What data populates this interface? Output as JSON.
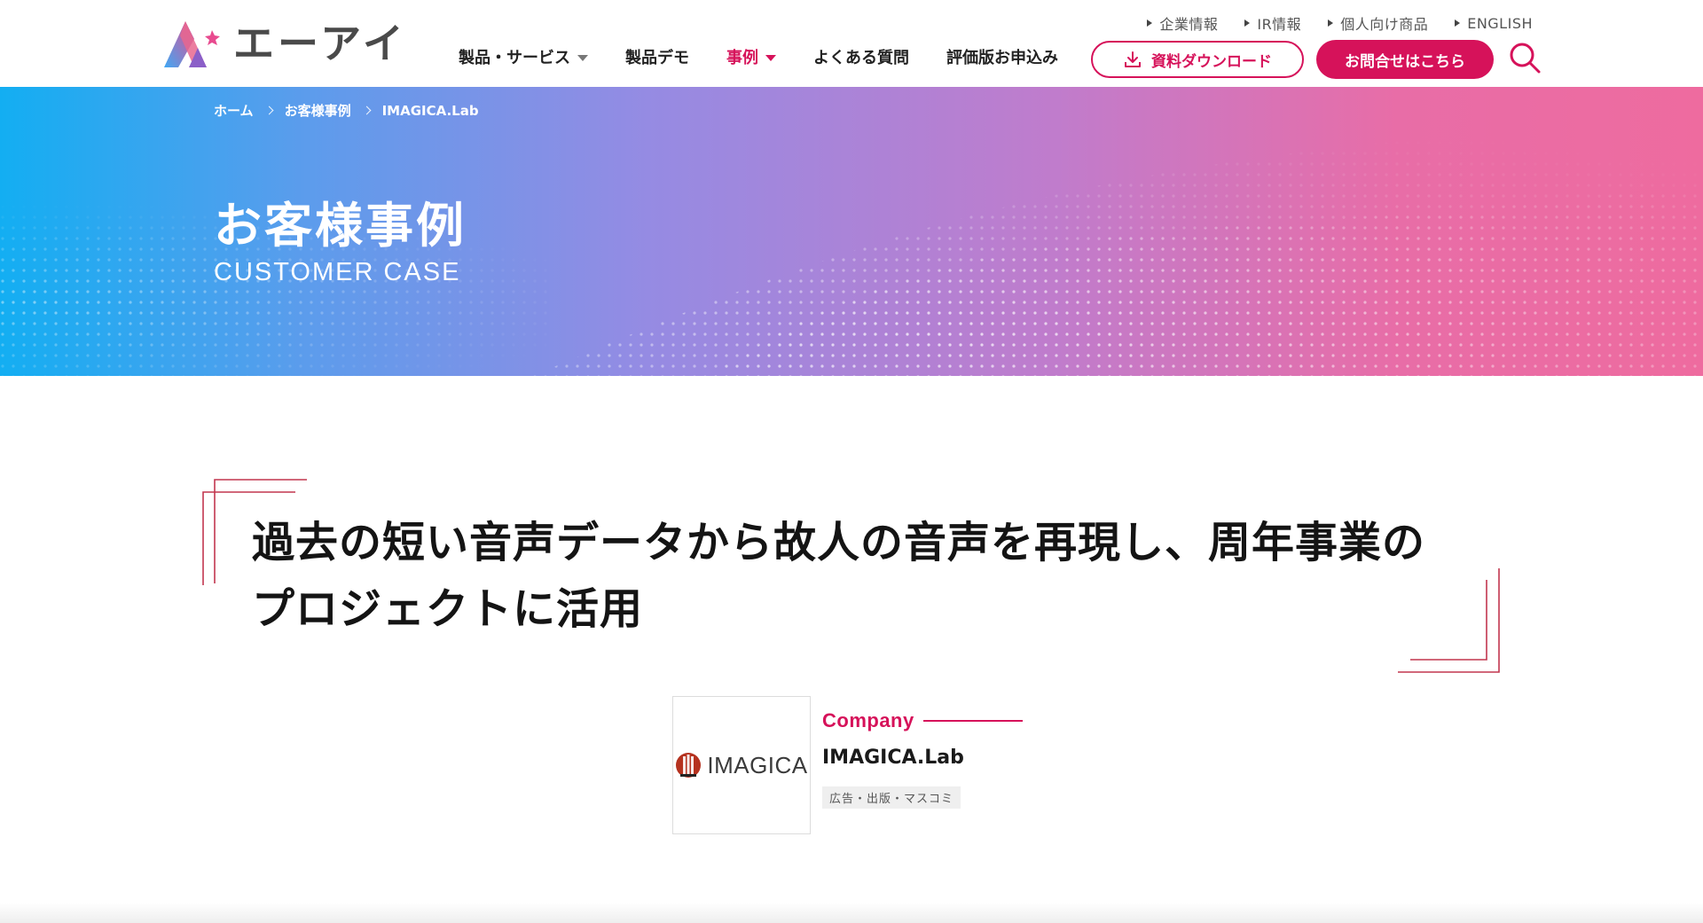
{
  "header": {
    "logo_text": "エーアイ",
    "util_nav": [
      {
        "label": "企業情報"
      },
      {
        "label": "IR情報"
      },
      {
        "label": "個人向け商品"
      },
      {
        "label": "ENGLISH"
      }
    ],
    "main_nav": [
      {
        "label": "製品・サービス",
        "has_dropdown": true,
        "active": false
      },
      {
        "label": "製品デモ",
        "has_dropdown": false,
        "active": false
      },
      {
        "label": "事例",
        "has_dropdown": true,
        "active": true
      },
      {
        "label": "よくある質問",
        "has_dropdown": false,
        "active": false
      },
      {
        "label": "評価版お申込み",
        "has_dropdown": false,
        "active": false
      }
    ],
    "download_button": "資料ダウンロード",
    "contact_button": "お問合せはこちら",
    "search_icon": "search-icon"
  },
  "hero": {
    "breadcrumb": [
      "ホーム",
      "お客様事例",
      "IMAGICA.Lab"
    ],
    "title": "お客様事例",
    "subtitle": "CUSTOMER CASE"
  },
  "article": {
    "headline_line1": "過去の短い音声データから故人の音声を再現し、周年事業の",
    "headline_line2": "プロジェクトに活用"
  },
  "company": {
    "logo_word": "IMAGICA",
    "label": "Company",
    "name": "IMAGICA.Lab",
    "tag": "広告・出版・マスコミ"
  },
  "colors": {
    "accent": "#d6125a",
    "hero_left": "#13aef2",
    "hero_right": "#ee6b9f"
  }
}
